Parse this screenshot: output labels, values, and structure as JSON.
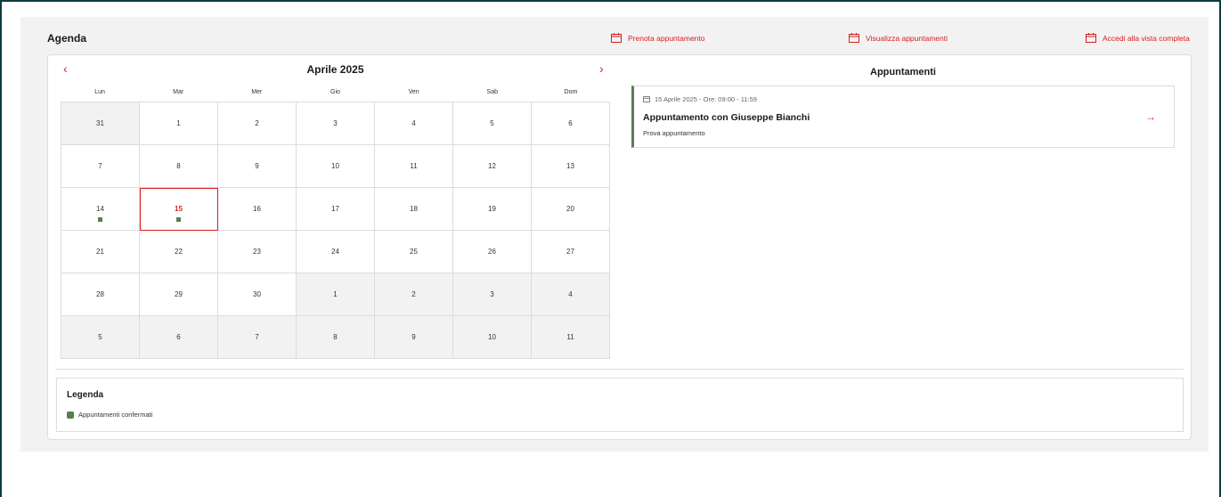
{
  "agenda": {
    "title": "Agenda",
    "actions": [
      {
        "label": "Prenota appuntamento",
        "icon": "calendar-icon"
      },
      {
        "label": "Visualizza appuntamenti",
        "icon": "calendar-icon"
      },
      {
        "label": "Accedi alla vista completa",
        "icon": "calendar-icon"
      }
    ]
  },
  "calendar": {
    "month_label": "Aprile 2025",
    "prev_icon": "chevron-left-icon",
    "next_icon": "chevron-right-icon",
    "weekdays": [
      "Lun",
      "Mar",
      "Mer",
      "Gio",
      "Ven",
      "Sab",
      "Dom"
    ],
    "weeks": [
      [
        {
          "d": "31",
          "other": true
        },
        {
          "d": "1"
        },
        {
          "d": "2"
        },
        {
          "d": "3"
        },
        {
          "d": "4"
        },
        {
          "d": "5"
        },
        {
          "d": "6"
        }
      ],
      [
        {
          "d": "7"
        },
        {
          "d": "8"
        },
        {
          "d": "9"
        },
        {
          "d": "10"
        },
        {
          "d": "11"
        },
        {
          "d": "12"
        },
        {
          "d": "13"
        }
      ],
      [
        {
          "d": "14",
          "dot": true
        },
        {
          "d": "15",
          "today": true,
          "dot": true
        },
        {
          "d": "16"
        },
        {
          "d": "17"
        },
        {
          "d": "18"
        },
        {
          "d": "19"
        },
        {
          "d": "20"
        }
      ],
      [
        {
          "d": "21"
        },
        {
          "d": "22"
        },
        {
          "d": "23"
        },
        {
          "d": "24"
        },
        {
          "d": "25"
        },
        {
          "d": "26"
        },
        {
          "d": "27"
        }
      ],
      [
        {
          "d": "28"
        },
        {
          "d": "29"
        },
        {
          "d": "30"
        },
        {
          "d": "1",
          "other": true
        },
        {
          "d": "2",
          "other": true
        },
        {
          "d": "3",
          "other": true
        },
        {
          "d": "4",
          "other": true
        }
      ],
      [
        {
          "d": "5",
          "other": true
        },
        {
          "d": "6",
          "other": true
        },
        {
          "d": "7",
          "other": true
        },
        {
          "d": "8",
          "other": true
        },
        {
          "d": "9",
          "other": true
        },
        {
          "d": "10",
          "other": true
        },
        {
          "d": "11",
          "other": true
        }
      ]
    ]
  },
  "appointments": {
    "title": "Appuntamenti",
    "items": [
      {
        "datetime": "15 Aprile 2025 - Ore: 09:00 - 11:59",
        "name": "Appuntamento con Giuseppe Bianchi",
        "description": "Prova appuntamento",
        "arrow_icon": "arrow-right-icon"
      }
    ]
  },
  "legend": {
    "title": "Legenda",
    "items": [
      {
        "label": "Appuntamenti confermati",
        "color": "#5a7d52"
      }
    ]
  },
  "colors": {
    "accent": "#d81e1e",
    "confirmed": "#5a7d52"
  }
}
